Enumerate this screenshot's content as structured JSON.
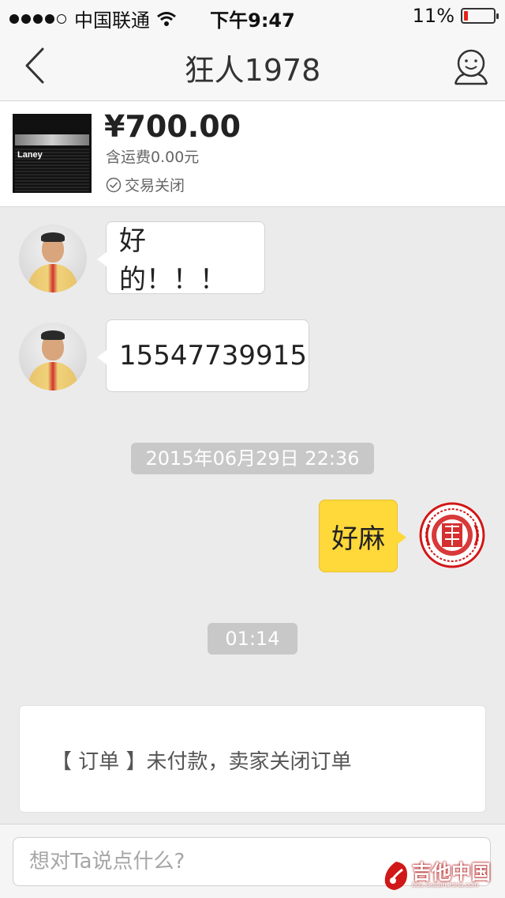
{
  "status_bar": {
    "carrier": "中国联通",
    "time": "下午9:47",
    "battery_percent": "11%",
    "battery_level": 0.11,
    "signal_dots": 4
  },
  "nav": {
    "title": "狂人1978",
    "back_icon": "chevron-left-icon",
    "profile_icon": "smiley-profile-icon"
  },
  "product": {
    "price": "¥700.00",
    "shipping": "含运费0.00元",
    "status": "交易关闭",
    "thumb_logo": "Laney"
  },
  "messages": [
    {
      "side": "left",
      "text": "好的！！！"
    },
    {
      "side": "left",
      "text": "15547739915"
    },
    {
      "type": "time",
      "text": "2015年06月29日 22:36"
    },
    {
      "side": "right",
      "text": "好麻"
    },
    {
      "type": "time",
      "text": "01:14"
    }
  ],
  "order": {
    "text": "【 订单 】未付款，卖家关闭订单"
  },
  "input": {
    "placeholder": "想对Ta说点什么?"
  },
  "watermark": {
    "text": "吉他中国",
    "sub": "bbs.GuitarChina.com"
  },
  "colors": {
    "my_bubble": "#ffd83a",
    "background": "#ebebeb",
    "battery_low": "#e2231a"
  }
}
